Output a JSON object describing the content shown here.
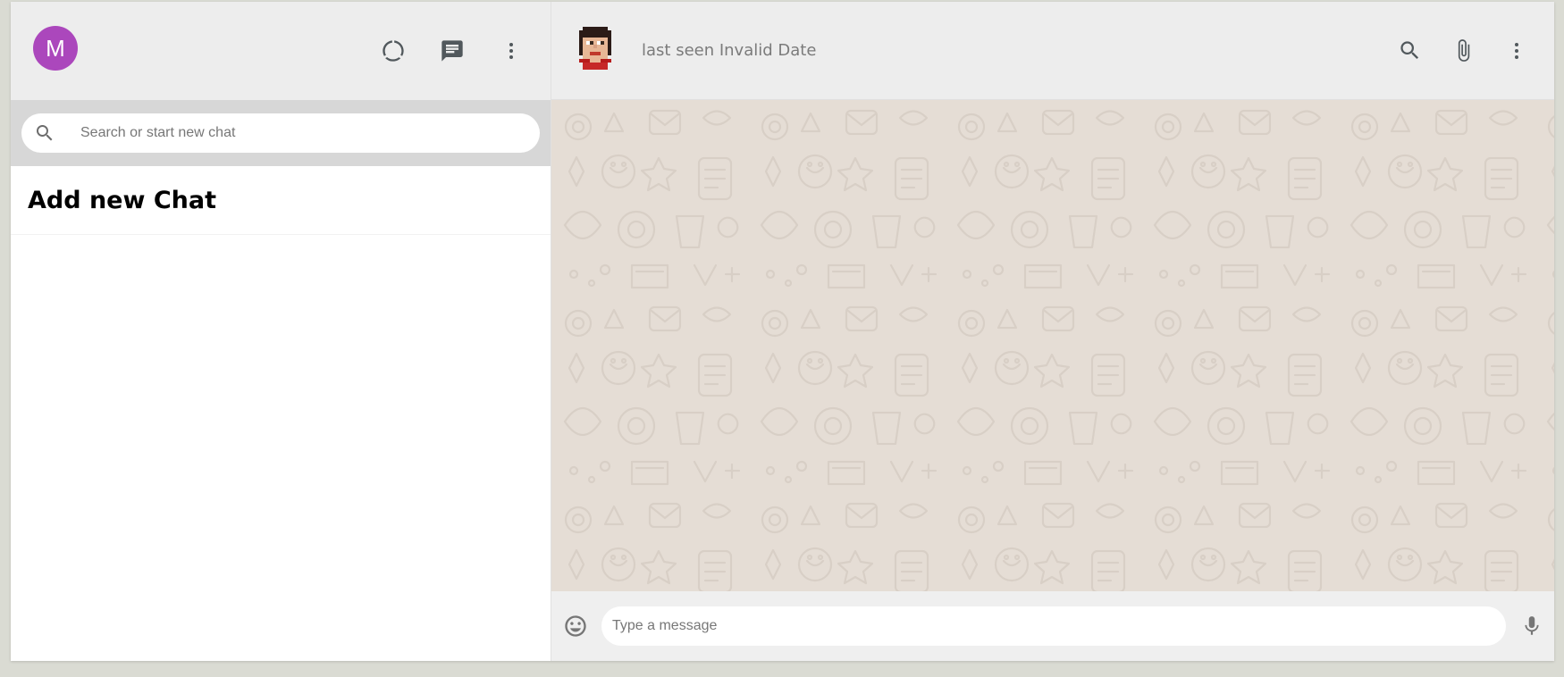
{
  "sidebar": {
    "user_avatar_letter": "M",
    "user_avatar_color": "#ab47bc",
    "icons": [
      "status-icon",
      "new-chat-icon",
      "menu-icon"
    ],
    "search_placeholder": "Search or start new chat",
    "add_chat_label": "Add new Chat"
  },
  "chat": {
    "last_seen": "last seen Invalid Date",
    "header_icons": [
      "search-icon",
      "attach-icon",
      "menu-icon"
    ],
    "message_placeholder": "Type a message",
    "background_color": "#e5ddd5"
  }
}
